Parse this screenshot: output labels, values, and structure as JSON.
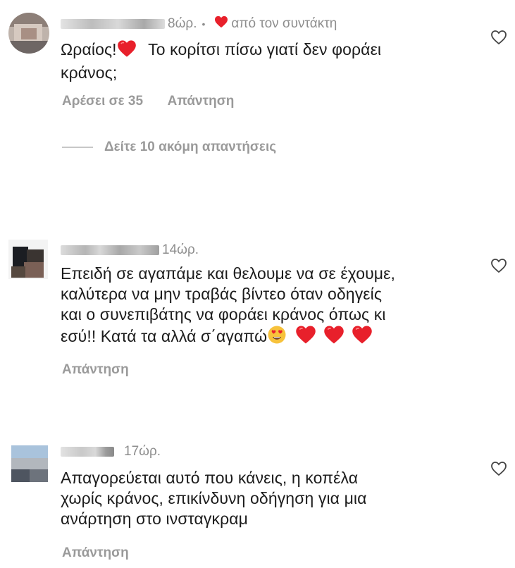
{
  "comments": [
    {
      "time": "8ώρ.",
      "separator": "•",
      "author_like": "από τον συντάκτη",
      "text_lines": [
        "Ωραίος!",
        "Το κορίτσι πίσω γιατί δεν φοράει",
        "κράνος;"
      ],
      "likes": "Αρέσει σε 35",
      "reply": "Απάντηση",
      "view_replies": "Δείτε 10 ακόμη απαντήσεις"
    },
    {
      "time": "14ώρ.",
      "text_lines": [
        "Επειδή σε αγαπάμε και θελουμε να σε έχουμε,",
        "καλύτερα να μην τραβάς βίντεο όταν οδηγείς",
        "και ο συνεπιβάτης να φοράει κράνος όπως κι",
        "εσύ!! Κατά τα αλλά σ΄αγαπώ"
      ],
      "reply": "Απάντηση"
    },
    {
      "time": "17ώρ.",
      "text_lines": [
        "Απαγορεύεται αυτό που κάνεις, η κοπέλα",
        "χωρίς κράνος,  επικίνδυνη οδήγηση για μια",
        "ανάρτηση στο ινσταγκραμ"
      ],
      "reply": "Απάντηση"
    }
  ],
  "icons": {
    "like": "heart-outline-icon",
    "author_like": "red-heart-icon",
    "emoji_love": "heart-eyes-emoji",
    "emoji_heart": "red-heart-emoji"
  },
  "colors": {
    "text": "#1c1c1c",
    "muted": "#8e8e8e",
    "heart_red": "#e8202b"
  }
}
